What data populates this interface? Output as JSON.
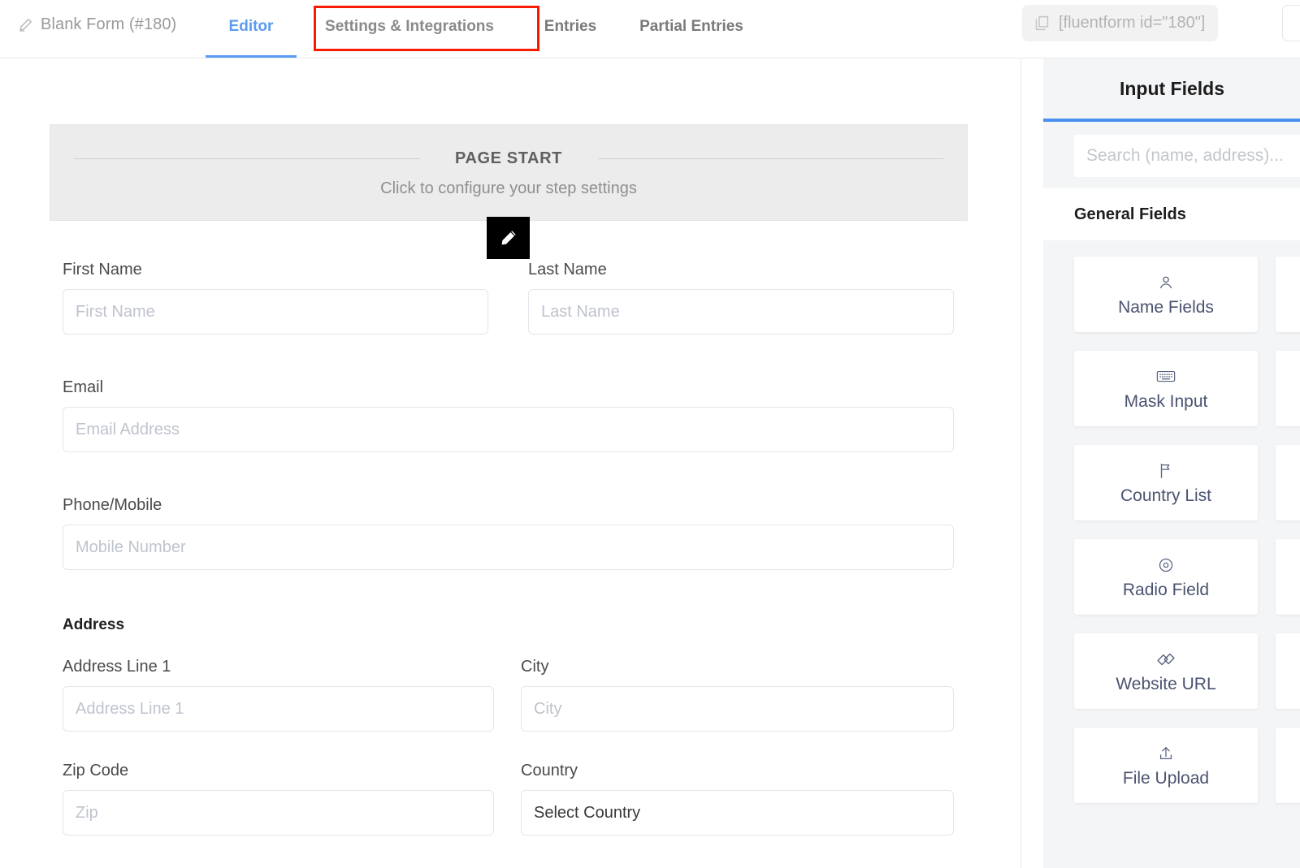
{
  "topbar": {
    "form_title": "Blank Form (#180)",
    "pencil_icon": "pencil-icon",
    "tabs": [
      {
        "label": "Editor",
        "active": true
      },
      {
        "label": "Settings & Integrations",
        "highlighted": true
      },
      {
        "label": "Entries"
      },
      {
        "label": "Partial Entries"
      }
    ],
    "shortcode": {
      "text": "[fluentform id=\"180\"]",
      "icon": "copy-icon"
    },
    "highlight_color": "#f81b00",
    "active_tab_color": "#5b9bf3"
  },
  "canvas": {
    "page_start": {
      "title": "PAGE START",
      "subtitle": "Click to configure your step settings"
    },
    "cursor": {
      "icon": "pencil-cursor-icon"
    },
    "fields": [
      {
        "label": "First Name",
        "placeholder": "First Name",
        "type": "text"
      },
      {
        "label": "Last Name",
        "placeholder": "Last Name",
        "type": "text"
      },
      {
        "label": "Email",
        "placeholder": "Email Address",
        "type": "text"
      },
      {
        "label": "Phone/Mobile",
        "placeholder": "Mobile Number",
        "type": "text"
      },
      {
        "label": "Address Line 1",
        "placeholder": "Address Line 1",
        "type": "text"
      },
      {
        "label": "City",
        "placeholder": "City",
        "type": "text"
      },
      {
        "label": "Zip Code",
        "placeholder": "Zip",
        "type": "text"
      },
      {
        "label": "Country",
        "value": "Select Country",
        "type": "select"
      }
    ],
    "address_section_label": "Address"
  },
  "sidebar": {
    "title": "Input Fields",
    "search_placeholder": "Search (name, address)...",
    "group_title": "General Fields",
    "accent_color": "#4a90f0",
    "cards": [
      {
        "label": "Name Fields",
        "icon": "user-icon"
      },
      {
        "label": "Mask Input",
        "icon": "keyboard-icon"
      },
      {
        "label": "Country List",
        "icon": "flag-icon"
      },
      {
        "label": "Radio Field",
        "icon": "radio-icon"
      },
      {
        "label": "Website URL",
        "icon": "link-icon"
      },
      {
        "label": "File Upload",
        "icon": "upload-icon"
      }
    ]
  }
}
